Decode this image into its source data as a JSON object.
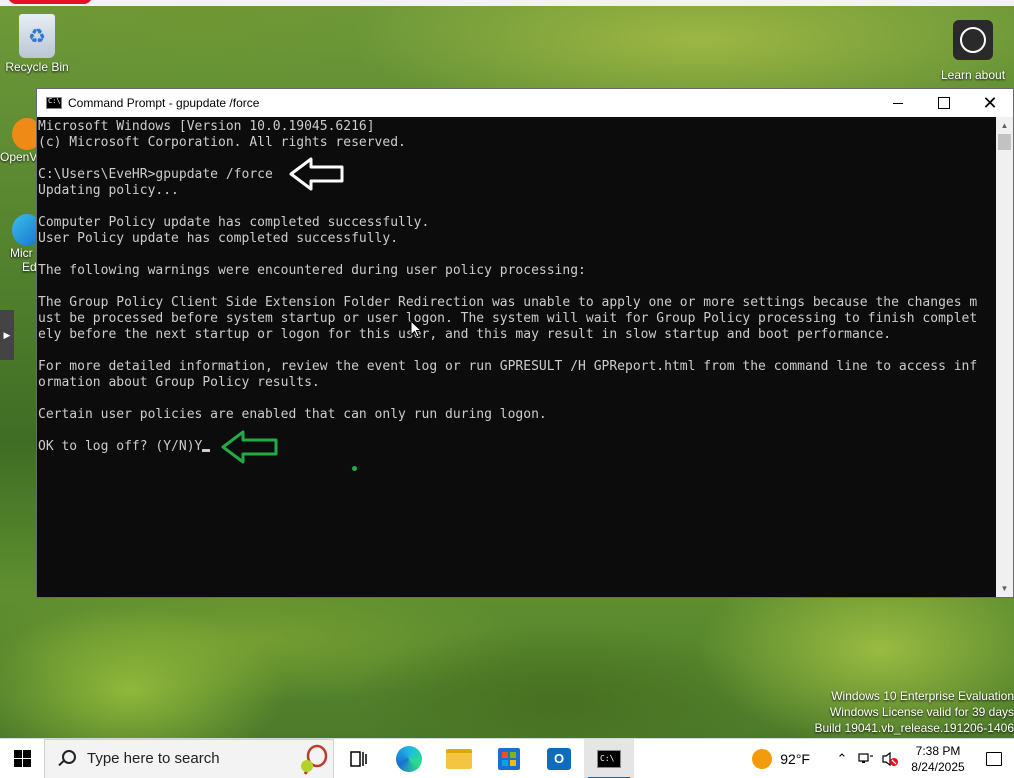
{
  "desktop": {
    "icons": {
      "recycle_bin": "Recycle Bin",
      "learn_about": "Learn about",
      "openvpn_partial": "OpenV",
      "edge_partial_1": "Micr",
      "edge_partial_2": "Ed"
    },
    "watermark": {
      "line1": "Windows 10 Enterprise Evaluation",
      "line2": "Windows License valid for 39 days",
      "line3": "Build 19041.vb_release.191206-1406"
    }
  },
  "cmd": {
    "title": "Command Prompt - gpupdate  /force",
    "lines": [
      "Microsoft Windows [Version 10.0.19045.6216]",
      "(c) Microsoft Corporation. All rights reserved.",
      "",
      "C:\\Users\\EveHR>gpupdate /force",
      "Updating policy...",
      "",
      "Computer Policy update has completed successfully.",
      "User Policy update has completed successfully.",
      "",
      "The following warnings were encountered during user policy processing:",
      "",
      "The Group Policy Client Side Extension Folder Redirection was unable to apply one or more settings because the changes m",
      "ust be processed before system startup or user logon. The system will wait for Group Policy processing to finish complet",
      "ely before the next startup or logon for this user, and this may result in slow startup and boot performance.",
      "",
      "For more detailed information, review the event log or run GPRESULT /H GPReport.html from the command line to access inf",
      "ormation about Group Policy results.",
      "",
      "Certain user policies are enabled that can only run during logon.",
      "",
      "OK to log off? (Y/N)Y"
    ]
  },
  "taskbar": {
    "search_placeholder": "Type here to search",
    "weather_temp": "92°F",
    "clock_time": "7:38 PM",
    "clock_date": "8/24/2025",
    "pinned": [
      "task-view-icon",
      "edge-icon",
      "file-explorer-icon",
      "store-icon",
      "outlook-icon",
      "command-prompt-icon"
    ]
  },
  "colors": {
    "console_bg": "#0c0c0c",
    "console_text": "#cccccc",
    "annotation_white": "#ffffff",
    "annotation_green": "#22aa44"
  }
}
